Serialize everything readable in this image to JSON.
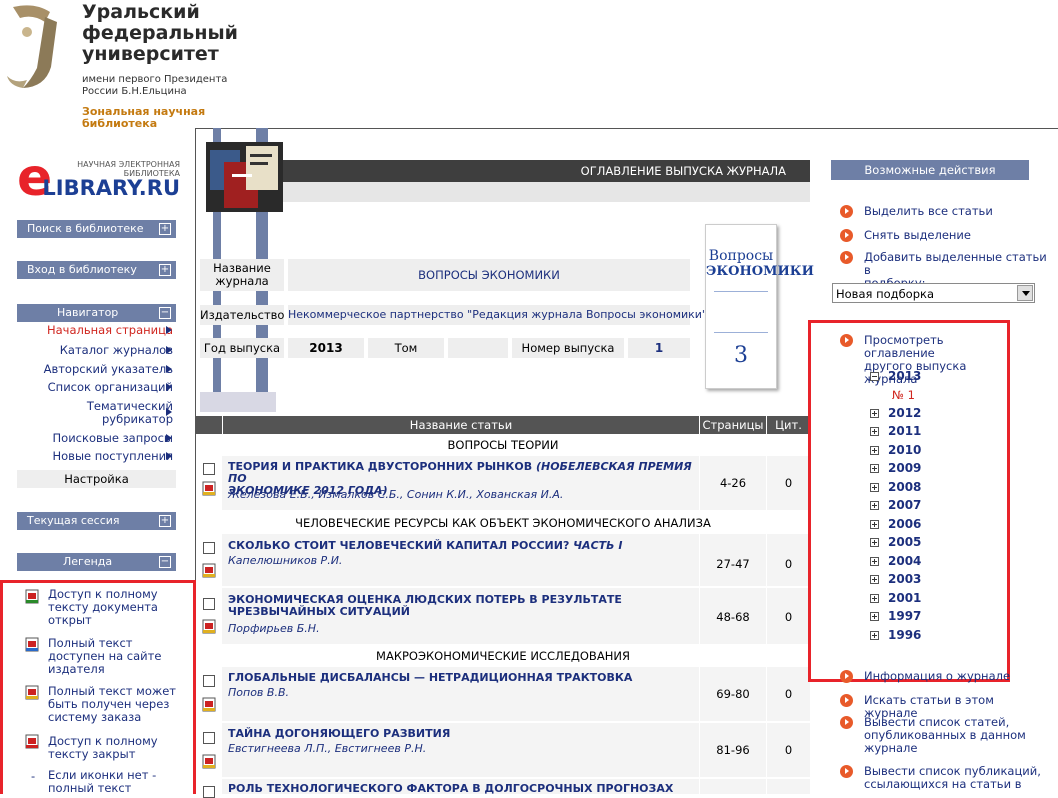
{
  "university": {
    "title_lines": [
      "Уральский",
      "федеральный",
      "университет"
    ],
    "subtitle_lines": [
      "имени первого Президента",
      "России Б.Н.Ельцина"
    ],
    "library_lines": [
      "Зональная научная",
      "библиотека"
    ]
  },
  "elibrary_logo": {
    "top_text": "НАУЧНАЯ ЭЛЕКТРОННАЯ",
    "mid_text": "БИБЛИОТЕКА",
    "brand": "LIBRARY.RU",
    "letter": "e"
  },
  "sidebar": {
    "search_label": "Поиск в библиотеке",
    "login_label": "Вход в библиотеку",
    "navigator_label": "Навигатор",
    "nav_items": [
      "Начальная страница",
      "Каталог журналов",
      "Авторский указатель",
      "Список организаций",
      "Тематический",
      "рубрикатор",
      "Поисковые запросы",
      "Новые поступления"
    ],
    "settings_label": "Настройка",
    "session_label": "Текущая сессия",
    "legend_label": "Легенда",
    "legend_items": [
      [
        "Доступ к полному",
        "тексту документа",
        "открыт"
      ],
      [
        "Полный текст",
        "доступен на сайте",
        "издателя"
      ],
      [
        "Полный текст может",
        "быть получен через",
        "систему заказа"
      ],
      [
        "Доступ к полному",
        "тексту закрыт"
      ],
      [
        "Если иконки нет -",
        "полный текст"
      ]
    ],
    "legend_dash": "-"
  },
  "header": {
    "title": "ОГЛАВЛЕНИЕ ВЫПУСКА ЖУРНАЛА"
  },
  "journal_info": {
    "name_label_1": "Название",
    "name_label_2": "журнала",
    "name_value": "ВОПРОСЫ ЭКОНОМИКИ",
    "publisher_label": "Издательство",
    "publisher_value": "Некоммерческое партнерство \"Редакция журнала Вопросы экономики\"",
    "year_label": "Год выпуска",
    "year_value": "2013",
    "volume_label": "Том",
    "issue_label": "Номер выпуска",
    "issue_value": "1"
  },
  "cover": {
    "title_1": "Вопросы",
    "title_2": "ЭКОНОМИКИ",
    "number": "3"
  },
  "table": {
    "col_title": "Название статьи",
    "col_pages": "Страницы",
    "col_cit": "Цит.",
    "sections": [
      "ВОПРОСЫ ТЕОРИИ",
      "ЧЕЛОВЕЧЕСКИЕ РЕСУРСЫ КАК ОБЪЕКТ ЭКОНОМИЧЕСКОГО АНАЛИЗА",
      "МАКРОЭКОНОМИЧЕСКИЕ ИССЛЕДОВАНИЯ"
    ],
    "articles": [
      {
        "title_1": "ТЕОРИЯ И ПРАКТИКА ДВУСТОРОННИХ РЫНКОВ",
        "title_italic_1": "(НОБЕЛЕВСКАЯ ПРЕМИЯ ПО",
        "title_italic_2": "ЭКОНОМИКЕ 2012 ГОДА)",
        "authors": "Железова Е.Б., Измалков С.Б., Сонин К.И., Хованская И.А.",
        "pages": "4-26",
        "cit": "0"
      },
      {
        "title_1": "СКОЛЬКО СТОИТ ЧЕЛОВЕЧЕСКИЙ КАПИТАЛ РОССИИ?",
        "title_italic_1": "ЧАСТЬ I",
        "authors": "Капелюшников Р.И.",
        "pages": "27-47",
        "cit": "0"
      },
      {
        "title_1": "ЭКОНОМИЧЕСКАЯ ОЦЕНКА ЛЮДСКИХ ПОТЕРЬ В РЕЗУЛЬТАТЕ",
        "title_2": "ЧРЕЗВЫЧАЙНЫХ СИТУАЦИЙ",
        "authors": "Порфирьев Б.Н.",
        "pages": "48-68",
        "cit": "0"
      },
      {
        "title_1": "ГЛОБАЛЬНЫЕ ДИСБАЛАНСЫ — НЕТРАДИЦИОННАЯ ТРАКТОВКА",
        "authors": "Попов В.В.",
        "pages": "69-80",
        "cit": "0"
      },
      {
        "title_1": "ТАЙНА ДОГОНЯЮЩЕГО РАЗВИТИЯ",
        "authors": "Евстигнеева Л.П., Евстигнеев Р.Н.",
        "pages": "81-96",
        "cit": "0"
      },
      {
        "title_1": "РОЛЬ ТЕХНОЛОГИЧЕСКОГО ФАКТОРА В ДОЛГОСРОЧНЫХ ПРОГНОЗАХ"
      }
    ]
  },
  "actions": {
    "header": "Возможные действия",
    "select_all": "Выделить все статьи",
    "deselect": "Снять выделение",
    "add_selected_1": "Добавить выделенные статьи в",
    "add_selected_2": "подборку:",
    "collection_value": "Новая подборка",
    "view_other_1": "Просмотреть оглавление",
    "view_other_2": "другого выпуска журнала",
    "current_year": "2013",
    "current_issue": "№ 1",
    "years": [
      "2012",
      "2011",
      "2010",
      "2009",
      "2008",
      "2007",
      "2006",
      "2005",
      "2004",
      "2003",
      "2001",
      "1997",
      "1996"
    ],
    "journal_info": "Информация о журнале",
    "search_in_journal": "Искать статьи в этом журнале",
    "list_published_1": "Вывести список статей,",
    "list_published_2": "опубликованных в данном",
    "list_published_3": "журнале",
    "list_citing_1": "Вывести список публикаций,",
    "list_citing_2": "ссылающихся на статьи в"
  },
  "colors": {
    "nav_blue": "#6e7fa6",
    "link_blue": "#1c2f7d",
    "highlight_red": "#e8232a",
    "dark_header": "#3e3e3e"
  }
}
